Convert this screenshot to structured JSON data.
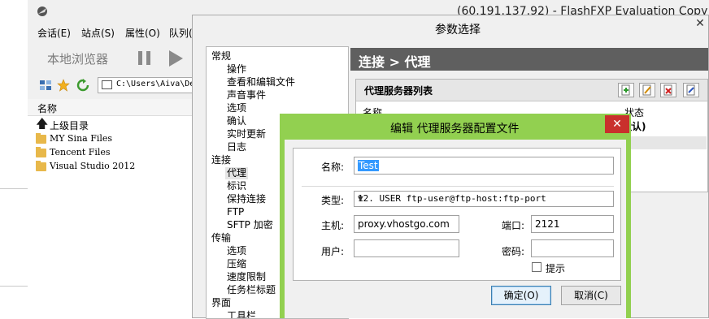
{
  "main_window": {
    "title": "(60.191.137.92) - FlashFXP Evaluation Copy",
    "menu": [
      "会话(E)",
      "站点(S)",
      "属性(O)",
      "队列("
    ],
    "local_browser_label": "本地浏览器",
    "path": "C:\\Users\\Aiva\\De",
    "file_list": {
      "header_name": "名称",
      "up_label": "上级目录",
      "folders": [
        "MY Sina Files",
        "Tencent Files",
        "Visual Studio 2012"
      ]
    }
  },
  "prefs_dialog": {
    "title": "参数选择",
    "tree": [
      {
        "label": "常规",
        "level": 0
      },
      {
        "label": "操作",
        "level": 1
      },
      {
        "label": "查看和编辑文件",
        "level": 1
      },
      {
        "label": "声音事件",
        "level": 1
      },
      {
        "label": "选项",
        "level": 1
      },
      {
        "label": "确认",
        "level": 1
      },
      {
        "label": "实时更新",
        "level": 1
      },
      {
        "label": "日志",
        "level": 1
      },
      {
        "label": "连接",
        "level": 0
      },
      {
        "label": "代理",
        "level": 1,
        "selected": true
      },
      {
        "label": "标识",
        "level": 1
      },
      {
        "label": "保持连接",
        "level": 1
      },
      {
        "label": "FTP",
        "level": 1
      },
      {
        "label": "SFTP 加密",
        "level": 1
      },
      {
        "label": "传输",
        "level": 0
      },
      {
        "label": "选项",
        "level": 1
      },
      {
        "label": "压缩",
        "level": 1
      },
      {
        "label": "速度限制",
        "level": 1
      },
      {
        "label": "任务栏标题",
        "level": 1
      },
      {
        "label": "界面",
        "level": 0
      },
      {
        "label": "工具栏",
        "level": 1
      }
    ],
    "page_header": "连接 > 代理",
    "proxy_list": {
      "title": "代理服务器列表",
      "col_name": "名称",
      "col_status": "状态",
      "row1_status": "默认)"
    }
  },
  "edit_dialog": {
    "title": "编辑 代理服务器配置文件",
    "name_label": "名称:",
    "name_value": "Test",
    "type_label": "类型:",
    "type_value": "12. USER ftp-user@ftp-host:ftp-port",
    "host_label": "主机:",
    "host_value": "proxy.vhostgo.com",
    "port_label": "端口:",
    "port_value": "2121",
    "user_label": "用户:",
    "user_value": "",
    "password_label": "密码:",
    "password_value": "",
    "hint_label": "提示",
    "hint_checked": false,
    "ok_label": "确定(O)",
    "cancel_label": "取消(C)",
    "titlebar_color": "#92d050"
  }
}
